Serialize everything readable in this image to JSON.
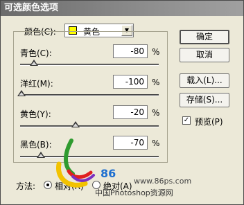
{
  "dialog": {
    "title": "可选颜色选项"
  },
  "color": {
    "label": "颜色(C):",
    "selected": "黄色",
    "swatch_color": "#ffff00"
  },
  "sliders": [
    {
      "label": "青色(C):",
      "value": "-80",
      "unit": "%",
      "level_percent": -80
    },
    {
      "label": "洋红(M):",
      "value": "-100",
      "unit": "%",
      "level_percent": -100
    },
    {
      "label": "黄色(Y):",
      "value": "-20",
      "unit": "%",
      "level_percent": -20
    },
    {
      "label": "黑色(B):",
      "value": "-70",
      "unit": "%",
      "level_percent": -70
    }
  ],
  "buttons": {
    "ok": "确定",
    "cancel": "取消",
    "load": "载入(L)...",
    "save": "存储(S)..."
  },
  "preview": {
    "label": "预览(P)",
    "checked": true
  },
  "method": {
    "label": "方法:",
    "relative": "相对(R)",
    "absolute": "绝对(A)",
    "selected": "relative"
  },
  "watermark": {
    "number": "86",
    "url": "www.86ps.com",
    "name": "中国Photoshop资源网"
  }
}
